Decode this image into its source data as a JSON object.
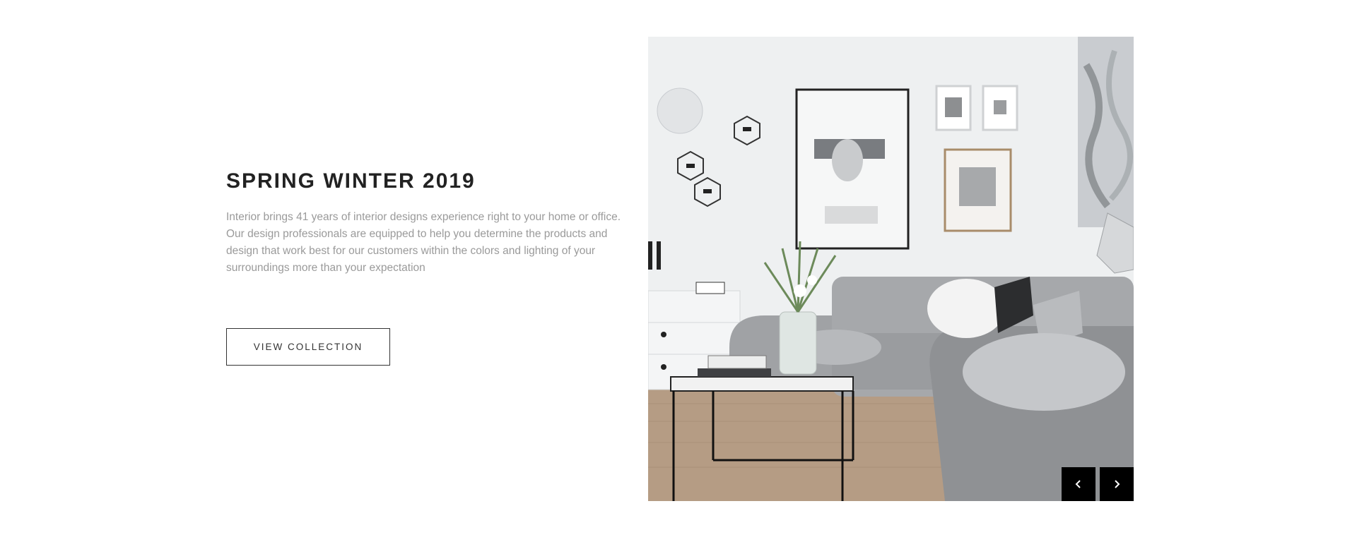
{
  "hero": {
    "title": "SPRING WINTER 2019",
    "description": "Interior brings 41 years of interior designs experience right to your home or office. Our design professionals are equipped to help you determine the products and design that work best for our customers within the colors and lighting of your surroundings more than your expectation",
    "cta_label": "VIEW COLLECTION"
  },
  "slider": {
    "prev_icon": "chevron-left-icon",
    "next_icon": "chevron-right-icon"
  },
  "colors": {
    "text_dark": "#222222",
    "text_muted": "#9a9a9a",
    "nav_bg": "#000000"
  }
}
